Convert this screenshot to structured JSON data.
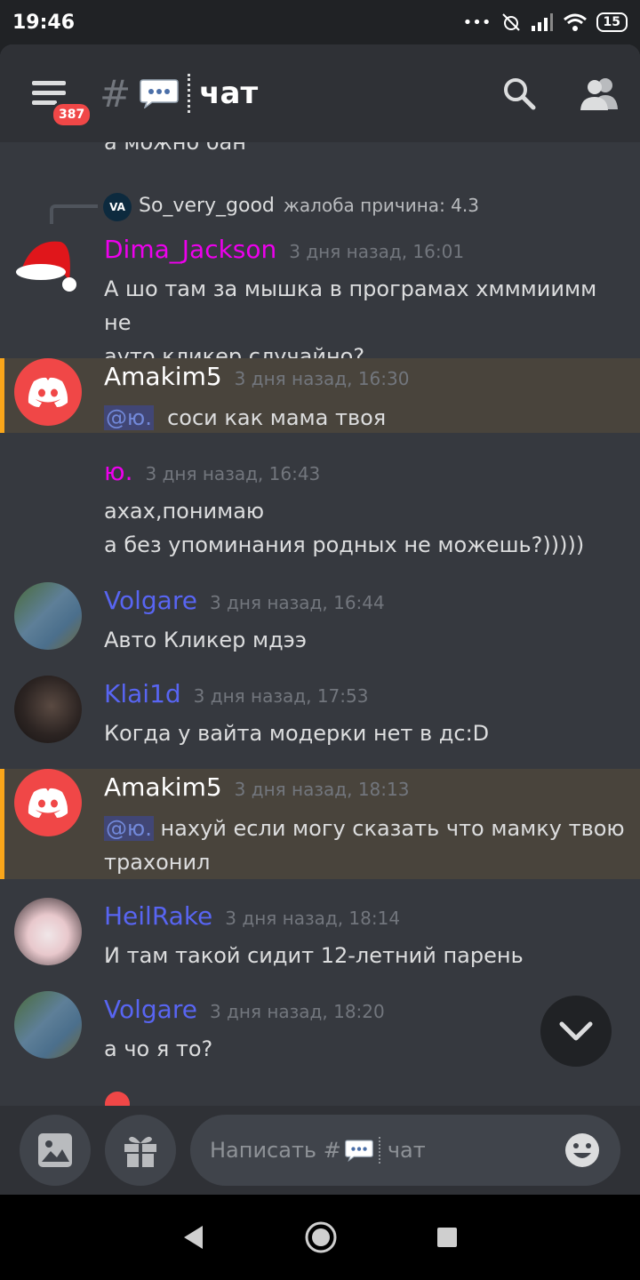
{
  "status_bar": {
    "time": "19:46",
    "signal_dots": "•••",
    "battery": "15"
  },
  "header": {
    "menu_badge": "387",
    "hash": "#",
    "channel_name": "чат"
  },
  "messages_cut_top": "а можно бан",
  "reply": {
    "user": "So_very_good",
    "text": "жалоба причина: 4.3",
    "avatar_text": "VA"
  },
  "messages": [
    {
      "user": "Dima_Jackson",
      "time": "3 дня назад, 16:01",
      "color": "#ed00ed",
      "line1": "А шо там за мышка в програмах хмммиимм не",
      "line2": "ауто кликер случайно?"
    },
    {
      "user": "Amakim5",
      "time": "3 дня назад, 16:30",
      "color": "#ffffff",
      "mention": "@ю.",
      "line1": "соси как мама твоя"
    },
    {
      "user": "ю.",
      "time": "3 дня назад, 16:43",
      "color": "#ed00ed",
      "line1": "ахах,понимаю",
      "line2": "а без упоминания родных не можешь?)))))"
    },
    {
      "user": "Volgare",
      "time": "3 дня назад, 16:44",
      "color": "#5865f2",
      "line1": "Авто Кликер мдээ"
    },
    {
      "user": "Klai1d",
      "time": "3 дня назад, 17:53",
      "color": "#5865f2",
      "line1": "Когда у вайта модерки нет в дс:D"
    },
    {
      "user": "Amakim5",
      "time": "3 дня назад, 18:13",
      "color": "#ffffff",
      "mention": "@ю.",
      "line1": "нахуй если могу сказать что мамку твою",
      "line2": "трахонил"
    },
    {
      "user": "HeilRake",
      "time": "3 дня назад, 18:14",
      "color": "#5865f2",
      "line1": "И там такой сидит 12-летний парень"
    },
    {
      "user": "Volgare",
      "time": "3 дня назад, 18:20",
      "color": "#5865f2",
      "line1": "а чо я то?"
    }
  ],
  "composer": {
    "placeholder_prefix": "Написать #",
    "placeholder_channel": "чат"
  },
  "icons": {
    "menu": "hamburger-menu-icon",
    "channel": "speech-bubble-emoji",
    "search": "search-icon",
    "members": "members-icon",
    "image": "image-icon",
    "gift": "gift-icon",
    "emoji": "emoji-icon",
    "scroll": "chevron-down-icon",
    "back": "back-triangle-icon",
    "home": "home-circle-icon",
    "recents": "recents-square-icon"
  },
  "colors": {
    "mention_bg": "#414675",
    "highlight": "#49443c",
    "highlight_bar": "#faa61a",
    "discord_red": "#f04747"
  }
}
